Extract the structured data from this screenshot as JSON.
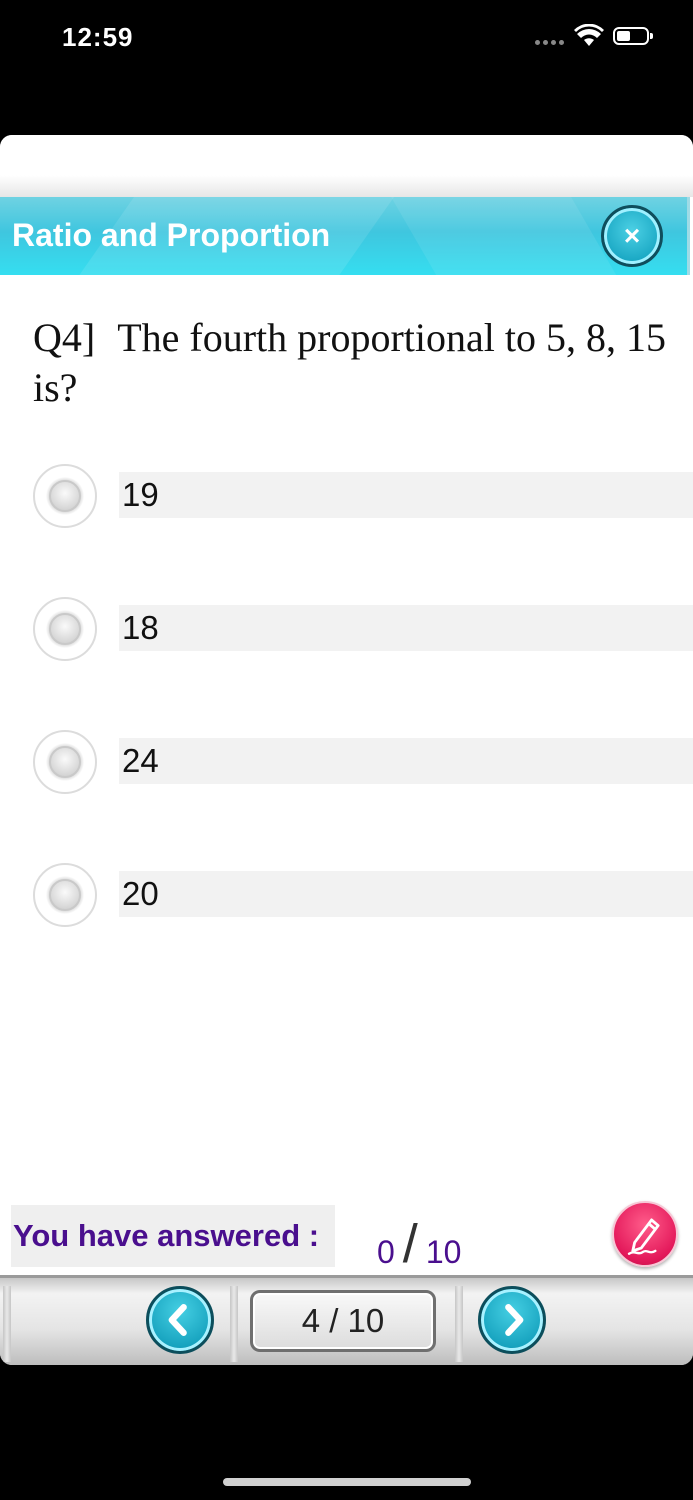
{
  "status_bar": {
    "time": "12:59"
  },
  "header": {
    "title": "Ratio and Proportion",
    "close_icon": "×"
  },
  "question": {
    "number": "Q4]",
    "text": "The fourth proportional to 5, 8, 15 is?"
  },
  "options": [
    {
      "label": "19"
    },
    {
      "label": "18"
    },
    {
      "label": "24"
    },
    {
      "label": "20"
    }
  ],
  "progress": {
    "label": "You have answered :",
    "answered": "0",
    "separator": "/",
    "total": "10"
  },
  "navigation": {
    "page": "4 / 10"
  },
  "colors": {
    "header": "#3fc6df",
    "accent_text": "#4a0f8e",
    "pencil_button": "#e3185a"
  }
}
